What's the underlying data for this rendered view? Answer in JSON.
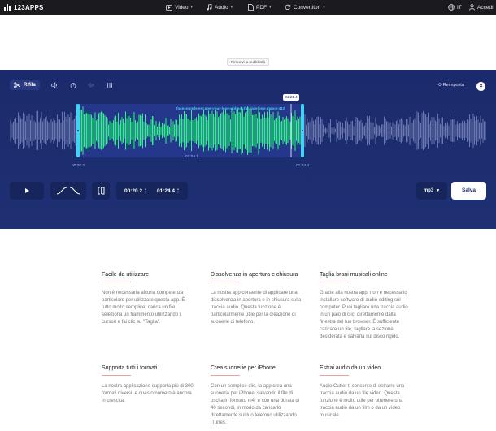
{
  "header": {
    "logo": "123APPS",
    "nav": [
      {
        "label": "Video",
        "icon": "video-icon"
      },
      {
        "label": "Audio",
        "icon": "music-note-icon"
      },
      {
        "label": "PDF",
        "icon": "document-icon"
      },
      {
        "label": "Convertitori",
        "icon": "refresh-icon"
      }
    ],
    "language": "IT",
    "login": "Accedi"
  },
  "ad": {
    "remove_label": "Rimuovi la pubblicità"
  },
  "editor": {
    "tools": {
      "trim_label": "Rifila"
    },
    "reset_label": "Reimposta",
    "filename": "facesounds-escape-your-love-upbeat-fashion-pop-dance-412",
    "cursor_time": "01:21.4",
    "start_marker": "00:20.2",
    "end_marker": "01:24.4",
    "duration_label": "01:04.1",
    "start_time": "00:20.2",
    "end_time": "01:24.4",
    "format": "mp3",
    "save_label": "Salva",
    "colors": {
      "background": "#1d2e70",
      "waveform_selected": "#2ff08a",
      "waveform_unselected": "#6a78b0",
      "handle": "#3fd3f5"
    }
  },
  "features": [
    {
      "title": "Facile da utilizzare",
      "text": "Non è necessaria alcuna competenza particolare per utilizzare questa app. È tutto molto semplice: carica un file, seleziona un frammento utilizzando i cursori e fai clic su \"Taglia\"."
    },
    {
      "title": "Dissolvenza in apertura e chiusura",
      "text": "La nostra app consente di applicare una dissolvenza in apertura e in chiusura sulla traccia audio. Questa funzione è particolarmente utile per la creazione di suonerie di telefono."
    },
    {
      "title": "Taglia brani musicali online",
      "text": "Grazie alla nostra app, non è necessario installare software di audio editing sul computer. Puoi tagliare una traccia audio in un paio di clic, direttamente dalla finestra del tuo browser. È sufficiente caricare un file, tagliare la sezione desiderata e salvarla sul disco rigido."
    },
    {
      "title": "Supporta tutti i formati",
      "text": "La nostra applicazione supporta più di 300 formati diversi, e questo numero è ancora in crescita."
    },
    {
      "title": "Crea suonerie per iPhone",
      "text": "Con un semplice clic, la app crea una suoneria per iPhone, salvando il file di uscita in formato m4r e con una durata di 40 secondi, in modo da caricarlo direttamente sul tuo telefono utilizzando iTunes."
    },
    {
      "title": "Estrai audio da un video",
      "text": "Audio Cutter ti consente di estrarre una traccia audio da un file video. Questa funzione è molto utile per ottenere una traccia audio da un film o da un video musicale."
    }
  ]
}
